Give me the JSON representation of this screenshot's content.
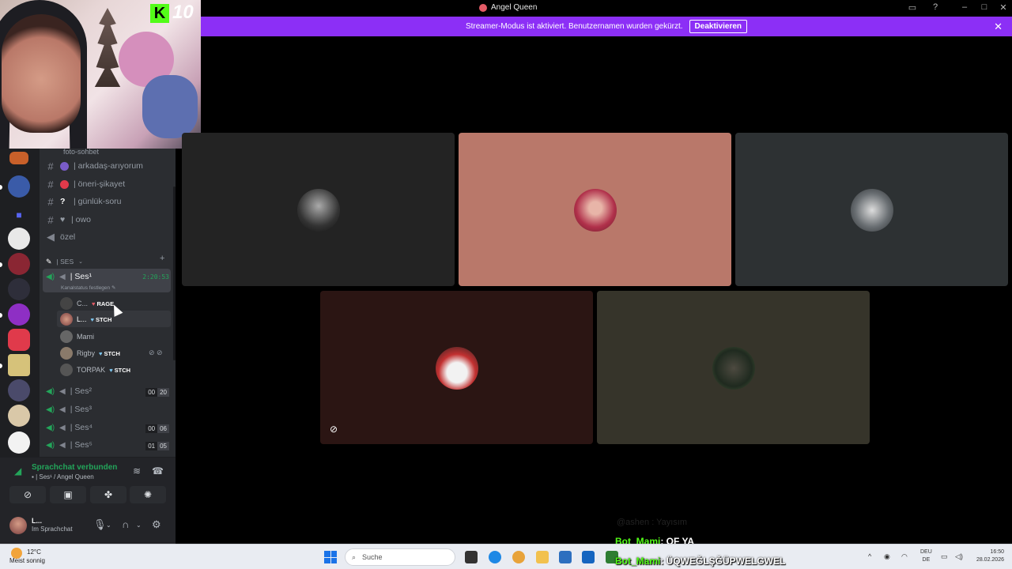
{
  "window": {
    "title": "Angel Queen"
  },
  "banner": {
    "text": "Streamer-Modus ist aktiviert. Benutzernamen wurden gekürzt.",
    "button": "Deaktivieren"
  },
  "webcam_overlay": {
    "number": "10",
    "logo_letter": "K"
  },
  "channels": {
    "top_cut": "foto-sohbet",
    "text": [
      {
        "name": "| arkadaş-arıyorum",
        "emoji_color": "#7a5cc9"
      },
      {
        "name": "| öneri-şikayet",
        "emoji_color": "#e03a4b"
      },
      {
        "name": "| günlük-soru",
        "emoji": "?"
      },
      {
        "name": "| owo",
        "emoji": "♥"
      }
    ],
    "voice_ozel": "özel",
    "category": "| SES",
    "active_voice": {
      "name": "| Ses¹",
      "time": "2:20:53",
      "status_hint": "Kanalstatus festlegen"
    },
    "members": [
      {
        "name": "C...",
        "tag": "RAGE",
        "tag_color": "#e35b66"
      },
      {
        "name": "L...",
        "tag": "STCH",
        "tag_color": "#7dc6f0"
      },
      {
        "name": "Mami",
        "tag": ""
      },
      {
        "name": "Rigby",
        "tag": "STCH",
        "tag_color": "#7dc6f0"
      },
      {
        "name": "TORPAK",
        "tag": "STCH",
        "tag_color": "#7dc6f0"
      }
    ],
    "other_voice": [
      {
        "name": "| Ses²",
        "count_a": "00",
        "count_b": "20"
      },
      {
        "name": "| Ses³",
        "count_a": "",
        "count_b": ""
      },
      {
        "name": "| Ses⁴",
        "count_a": "00",
        "count_b": "06"
      },
      {
        "name": "| Ses⁵",
        "count_a": "01",
        "count_b": "05"
      }
    ]
  },
  "voice_panel": {
    "status": "Sprachchat verbunden",
    "channel": "| Ses¹ / Angel Queen"
  },
  "user_panel": {
    "name": "L...",
    "status": "Im Sprachchat"
  },
  "chat_overlay": [
    {
      "user": "Bot_Mami",
      "message": ": OF YA"
    },
    {
      "user": "Bot_Mami",
      "message": ": ÜQWEĞLŞĞÜPWELGWEL"
    }
  ],
  "chat_ghost": "@ashen : Yayısım",
  "taskbar": {
    "weather_temp": "12°C",
    "weather_desc": "Meist sonnig",
    "search": "Suche",
    "lang_top": "DEU",
    "lang_bottom": "DE",
    "time": "16:50",
    "date": "28.02.2026"
  },
  "colors": {
    "banner": "#8c2ff6",
    "accent_green": "#23a55a",
    "chat_name": "#53fc18"
  }
}
